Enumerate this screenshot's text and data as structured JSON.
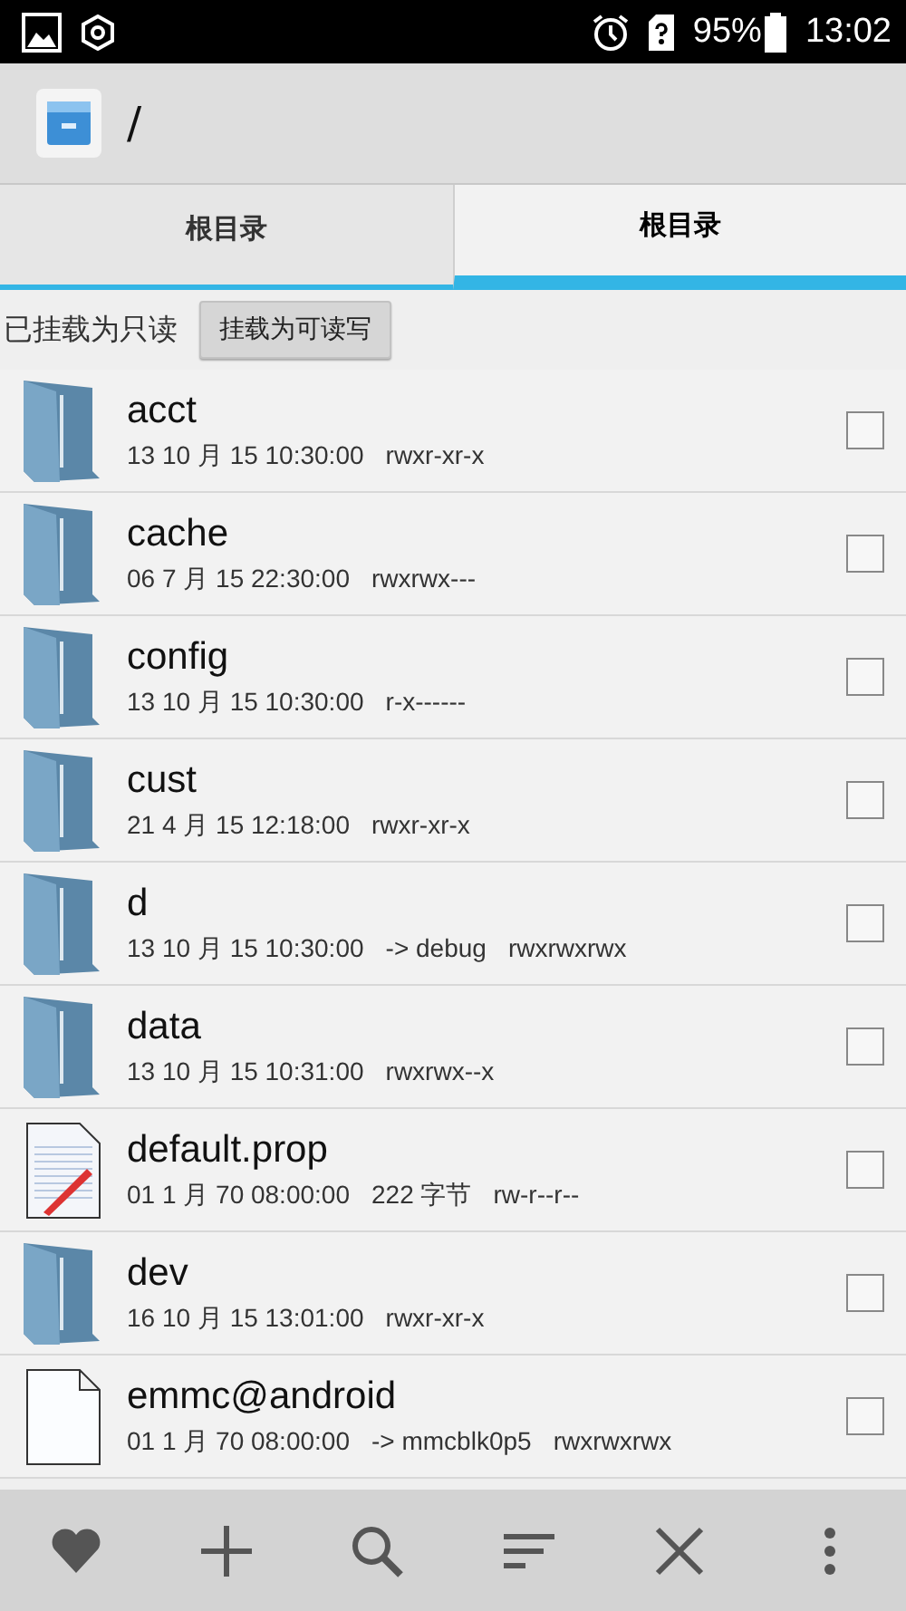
{
  "status_bar": {
    "battery": "95%",
    "time": "13:02"
  },
  "app_bar": {
    "path": "/"
  },
  "tabs": [
    {
      "label": "根目录",
      "selected": false
    },
    {
      "label": "根目录",
      "selected": true
    }
  ],
  "mount": {
    "status": "已挂载为只读",
    "button": "挂载为可读写"
  },
  "files": [
    {
      "kind": "folder",
      "name": "acct",
      "date": "13 10 月 15 10:30:00",
      "perms": "rwxr-xr-x",
      "checked": false
    },
    {
      "kind": "folder",
      "name": "cache",
      "date": "06 7 月 15 22:30:00",
      "perms": "rwxrwx---",
      "checked": false
    },
    {
      "kind": "folder",
      "name": "config",
      "date": "13 10 月 15 10:30:00",
      "perms": "r-x------",
      "checked": false
    },
    {
      "kind": "folder",
      "name": "cust",
      "date": "21 4 月 15 12:18:00",
      "perms": "rwxr-xr-x",
      "checked": false
    },
    {
      "kind": "folder",
      "name": "d",
      "date": "13 10 月 15 10:30:00",
      "extra": "-> debug",
      "perms": "rwxrwxrwx",
      "checked": false
    },
    {
      "kind": "folder",
      "name": "data",
      "date": "13 10 月 15 10:31:00",
      "perms": "rwxrwx--x",
      "checked": false
    },
    {
      "kind": "text",
      "name": "default.prop",
      "date": "01 1 月 70 08:00:00",
      "extra": "222 字节",
      "perms": "rw-r--r--",
      "checked": false
    },
    {
      "kind": "folder",
      "name": "dev",
      "date": "16 10 月 15 13:01:00",
      "perms": "rwxr-xr-x",
      "checked": false
    },
    {
      "kind": "file",
      "name": "emmc@android",
      "date": "01 1 月 70 08:00:00",
      "extra": "-> mmcblk0p5",
      "perms": "rwxrwxrwx",
      "checked": false
    }
  ],
  "toolbar": [
    {
      "kind": "favorite"
    },
    {
      "kind": "add"
    },
    {
      "kind": "search"
    },
    {
      "kind": "sort"
    },
    {
      "kind": "close"
    },
    {
      "kind": "more"
    }
  ]
}
